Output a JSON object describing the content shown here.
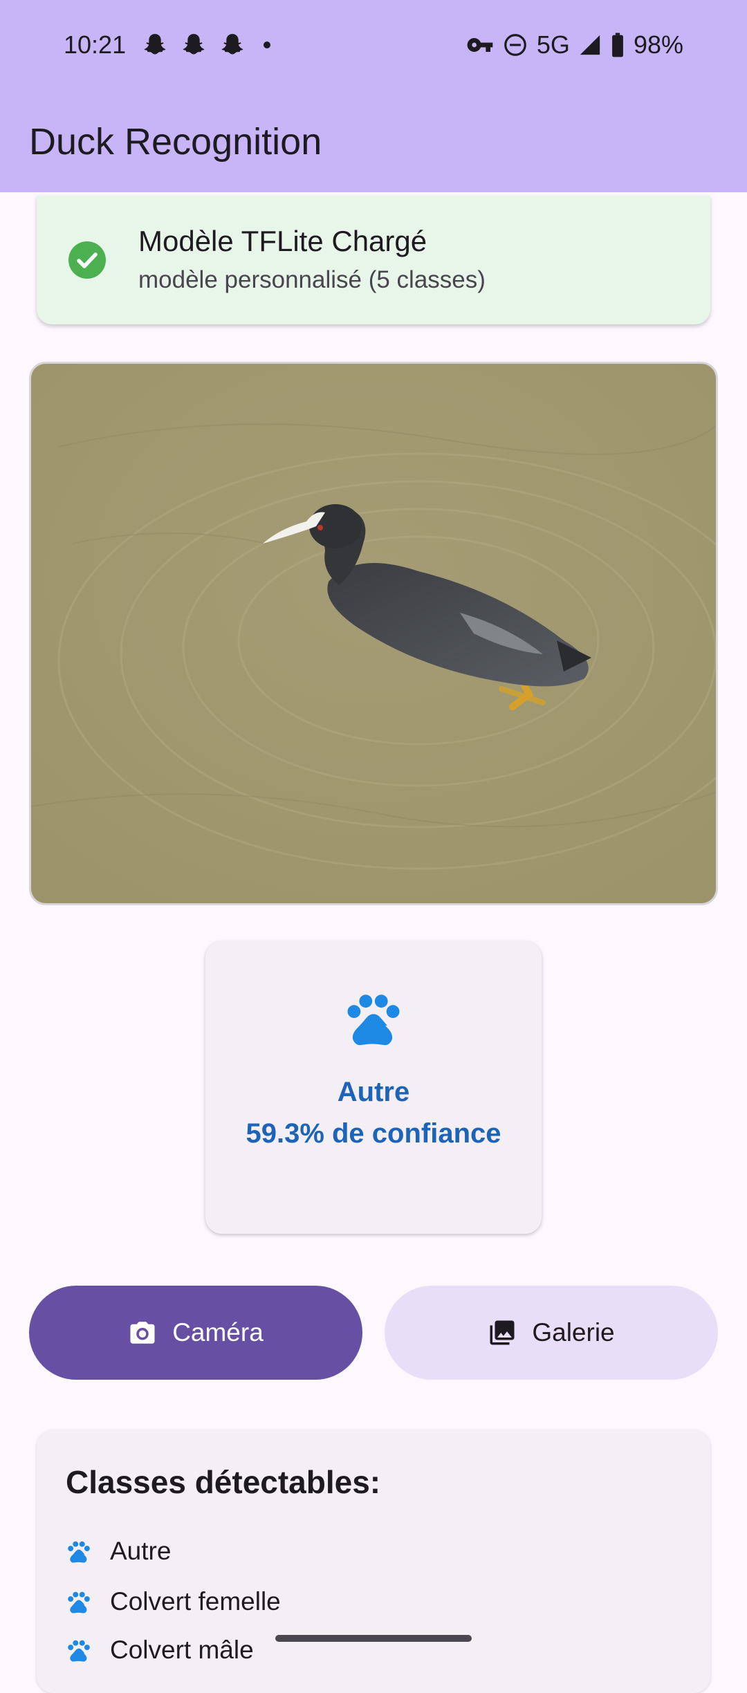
{
  "status_bar": {
    "time": "10:21",
    "left_icons": [
      "snapchat-icon",
      "snapchat-icon",
      "snapchat-icon",
      "notification-dot-icon"
    ],
    "right_icons": [
      "vpn-key-icon",
      "do-not-disturb-icon"
    ],
    "network": "5G",
    "battery": "98%"
  },
  "app_bar": {
    "title": "Duck Recognition",
    "background": "#c7b5f7"
  },
  "model_status": {
    "title": "Modèle TFLite Chargé",
    "subtitle": "modèle personnalisé (5 classes)",
    "icon": "check-circle-icon",
    "accent": "#4caf50"
  },
  "photo": {
    "subject": "coot-on-water"
  },
  "result": {
    "icon": "paw-icon",
    "label": "Autre",
    "confidence": "59.3% de confiance",
    "color": "#1d64b8"
  },
  "actions": {
    "camera_label": "Caméra",
    "gallery_label": "Galerie",
    "primary_color": "#6750a4",
    "secondary_color": "#e8def8"
  },
  "classes": {
    "title": "Classes détectables:",
    "items": [
      "Autre",
      "Colvert femelle",
      "Colvert mâle"
    ]
  }
}
